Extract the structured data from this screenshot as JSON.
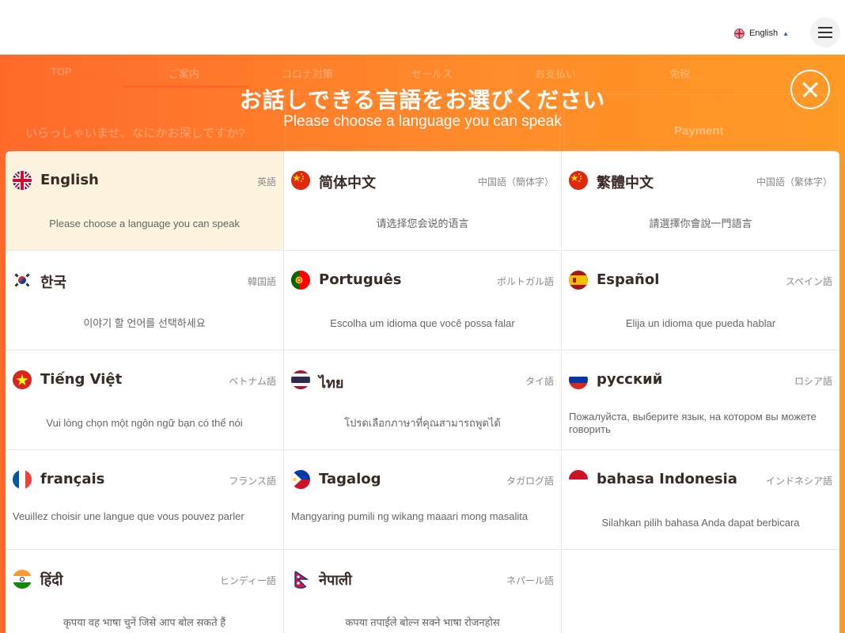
{
  "header": {
    "language_label": "English",
    "language_flag_icon": "uk-flag-icon",
    "caret_icon": "caret-up-icon",
    "menu_icon": "hamburger-menu-icon"
  },
  "background_nav": {
    "tabs": [
      "TOP",
      "ご案内",
      "コロナ対策",
      "セールス",
      "お支払い",
      "免税"
    ],
    "search_prompt": "いらっしゃいませ、なにかお探しですか?",
    "payment_label": "Payment"
  },
  "modal": {
    "title_ja": "お話しできる言語をお選びください",
    "title_en": "Please choose a language you can speak",
    "close_icon": "close-icon"
  },
  "languages": [
    {
      "name": "English",
      "jname": "英語",
      "desc": "Please choose a language you can speak",
      "flag": "uk",
      "selected": true
    },
    {
      "name": "简体中文",
      "jname": "中国語（簡体字）",
      "desc": "请选择您会说的语言",
      "flag": "cn"
    },
    {
      "name": "繁體中文",
      "jname": "中国語（繁体字）",
      "desc": "請選擇你會說一門語言",
      "flag": "cn"
    },
    {
      "name": "한국",
      "jname": "韓国語",
      "desc": "이야기 할 언어를 선택하세요",
      "flag": "kr"
    },
    {
      "name": "Português",
      "jname": "ポルトガル語",
      "desc": "Escolha um idioma que você possa falar",
      "flag": "pt"
    },
    {
      "name": "Español",
      "jname": "スペイン語",
      "desc": "Elija un idioma que pueda hablar",
      "flag": "es"
    },
    {
      "name": "Tiếng Việt",
      "jname": "ベトナム語",
      "desc": "Vui lòng chọn một ngôn ngữ bạn có thể nói",
      "flag": "vn"
    },
    {
      "name": "ไทย",
      "jname": "タイ語",
      "desc": "โปรดเลือกภาษาที่คุณสามารถพูดได้",
      "flag": "th"
    },
    {
      "name": "русский",
      "jname": "ロシア語",
      "desc": "Пожалуйста, выберите язык, на котором вы можете говорить",
      "flag": "ru",
      "left": true
    },
    {
      "name": "français",
      "jname": "フランス語",
      "desc": "Veuillez choisir une langue que vous pouvez parler",
      "flag": "fr",
      "left": true
    },
    {
      "name": "Tagalog",
      "jname": "タガログ語",
      "desc": "Mangyaring pumili ng wikang maaari mong masalita",
      "flag": "ph",
      "left": true
    },
    {
      "name": "bahasa Indonesia",
      "jname": "インドネシア語",
      "desc": "Silahkan pilih bahasa Anda dapat berbicara",
      "flag": "id"
    },
    {
      "name": "हिंदी",
      "jname": "ヒンディー語",
      "desc": "कृपया वह भाषा चुनें जिसे आप बोल सकते हैं",
      "flag": "in"
    },
    {
      "name": "नेपाली",
      "jname": "ネパール語",
      "desc": "कपया तपाईले बोल्न सक्ने भाषा रोजनहोस",
      "flag": "np"
    },
    {
      "name": "",
      "jname": "",
      "desc": "",
      "flag": ""
    }
  ]
}
